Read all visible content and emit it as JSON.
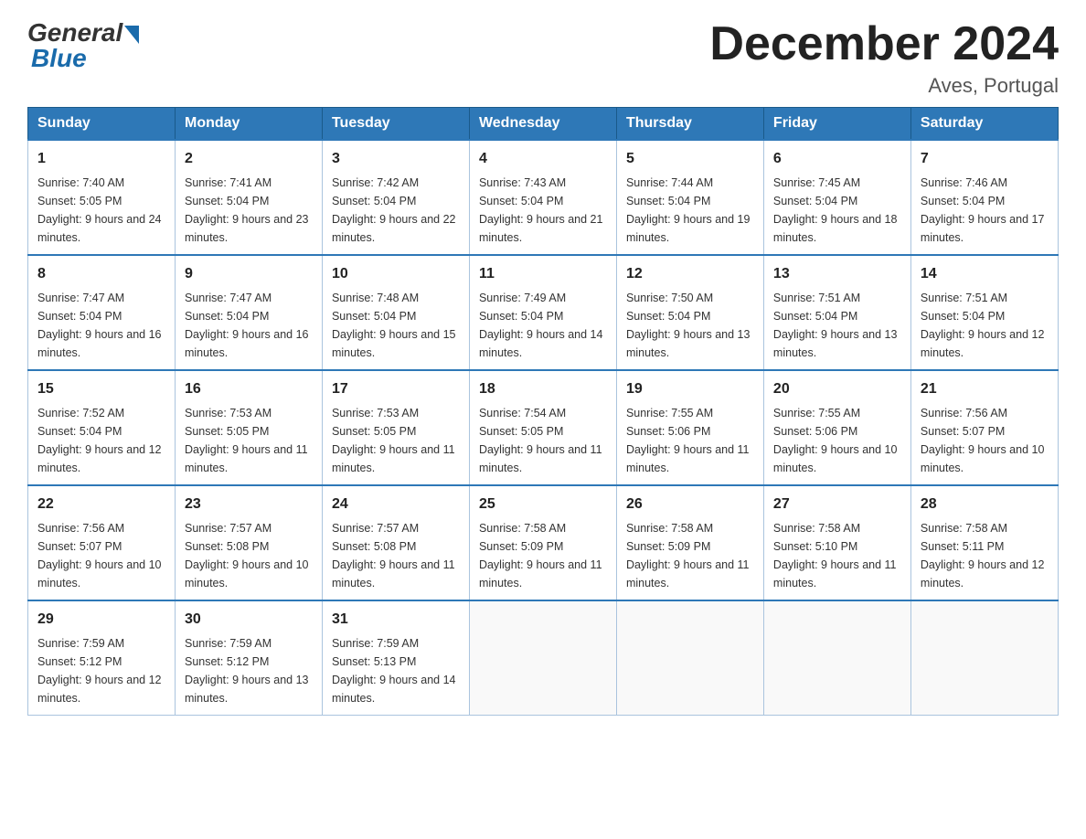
{
  "header": {
    "logo_general": "General",
    "logo_blue": "Blue",
    "title": "December 2024",
    "location": "Aves, Portugal"
  },
  "days_of_week": [
    "Sunday",
    "Monday",
    "Tuesday",
    "Wednesday",
    "Thursday",
    "Friday",
    "Saturday"
  ],
  "weeks": [
    [
      {
        "day": 1,
        "sunrise": "7:40 AM",
        "sunset": "5:05 PM",
        "daylight": "9 hours and 24 minutes."
      },
      {
        "day": 2,
        "sunrise": "7:41 AM",
        "sunset": "5:04 PM",
        "daylight": "9 hours and 23 minutes."
      },
      {
        "day": 3,
        "sunrise": "7:42 AM",
        "sunset": "5:04 PM",
        "daylight": "9 hours and 22 minutes."
      },
      {
        "day": 4,
        "sunrise": "7:43 AM",
        "sunset": "5:04 PM",
        "daylight": "9 hours and 21 minutes."
      },
      {
        "day": 5,
        "sunrise": "7:44 AM",
        "sunset": "5:04 PM",
        "daylight": "9 hours and 19 minutes."
      },
      {
        "day": 6,
        "sunrise": "7:45 AM",
        "sunset": "5:04 PM",
        "daylight": "9 hours and 18 minutes."
      },
      {
        "day": 7,
        "sunrise": "7:46 AM",
        "sunset": "5:04 PM",
        "daylight": "9 hours and 17 minutes."
      }
    ],
    [
      {
        "day": 8,
        "sunrise": "7:47 AM",
        "sunset": "5:04 PM",
        "daylight": "9 hours and 16 minutes."
      },
      {
        "day": 9,
        "sunrise": "7:47 AM",
        "sunset": "5:04 PM",
        "daylight": "9 hours and 16 minutes."
      },
      {
        "day": 10,
        "sunrise": "7:48 AM",
        "sunset": "5:04 PM",
        "daylight": "9 hours and 15 minutes."
      },
      {
        "day": 11,
        "sunrise": "7:49 AM",
        "sunset": "5:04 PM",
        "daylight": "9 hours and 14 minutes."
      },
      {
        "day": 12,
        "sunrise": "7:50 AM",
        "sunset": "5:04 PM",
        "daylight": "9 hours and 13 minutes."
      },
      {
        "day": 13,
        "sunrise": "7:51 AM",
        "sunset": "5:04 PM",
        "daylight": "9 hours and 13 minutes."
      },
      {
        "day": 14,
        "sunrise": "7:51 AM",
        "sunset": "5:04 PM",
        "daylight": "9 hours and 12 minutes."
      }
    ],
    [
      {
        "day": 15,
        "sunrise": "7:52 AM",
        "sunset": "5:04 PM",
        "daylight": "9 hours and 12 minutes."
      },
      {
        "day": 16,
        "sunrise": "7:53 AM",
        "sunset": "5:05 PM",
        "daylight": "9 hours and 11 minutes."
      },
      {
        "day": 17,
        "sunrise": "7:53 AM",
        "sunset": "5:05 PM",
        "daylight": "9 hours and 11 minutes."
      },
      {
        "day": 18,
        "sunrise": "7:54 AM",
        "sunset": "5:05 PM",
        "daylight": "9 hours and 11 minutes."
      },
      {
        "day": 19,
        "sunrise": "7:55 AM",
        "sunset": "5:06 PM",
        "daylight": "9 hours and 11 minutes."
      },
      {
        "day": 20,
        "sunrise": "7:55 AM",
        "sunset": "5:06 PM",
        "daylight": "9 hours and 10 minutes."
      },
      {
        "day": 21,
        "sunrise": "7:56 AM",
        "sunset": "5:07 PM",
        "daylight": "9 hours and 10 minutes."
      }
    ],
    [
      {
        "day": 22,
        "sunrise": "7:56 AM",
        "sunset": "5:07 PM",
        "daylight": "9 hours and 10 minutes."
      },
      {
        "day": 23,
        "sunrise": "7:57 AM",
        "sunset": "5:08 PM",
        "daylight": "9 hours and 10 minutes."
      },
      {
        "day": 24,
        "sunrise": "7:57 AM",
        "sunset": "5:08 PM",
        "daylight": "9 hours and 11 minutes."
      },
      {
        "day": 25,
        "sunrise": "7:58 AM",
        "sunset": "5:09 PM",
        "daylight": "9 hours and 11 minutes."
      },
      {
        "day": 26,
        "sunrise": "7:58 AM",
        "sunset": "5:09 PM",
        "daylight": "9 hours and 11 minutes."
      },
      {
        "day": 27,
        "sunrise": "7:58 AM",
        "sunset": "5:10 PM",
        "daylight": "9 hours and 11 minutes."
      },
      {
        "day": 28,
        "sunrise": "7:58 AM",
        "sunset": "5:11 PM",
        "daylight": "9 hours and 12 minutes."
      }
    ],
    [
      {
        "day": 29,
        "sunrise": "7:59 AM",
        "sunset": "5:12 PM",
        "daylight": "9 hours and 12 minutes."
      },
      {
        "day": 30,
        "sunrise": "7:59 AM",
        "sunset": "5:12 PM",
        "daylight": "9 hours and 13 minutes."
      },
      {
        "day": 31,
        "sunrise": "7:59 AM",
        "sunset": "5:13 PM",
        "daylight": "9 hours and 14 minutes."
      },
      null,
      null,
      null,
      null
    ]
  ]
}
